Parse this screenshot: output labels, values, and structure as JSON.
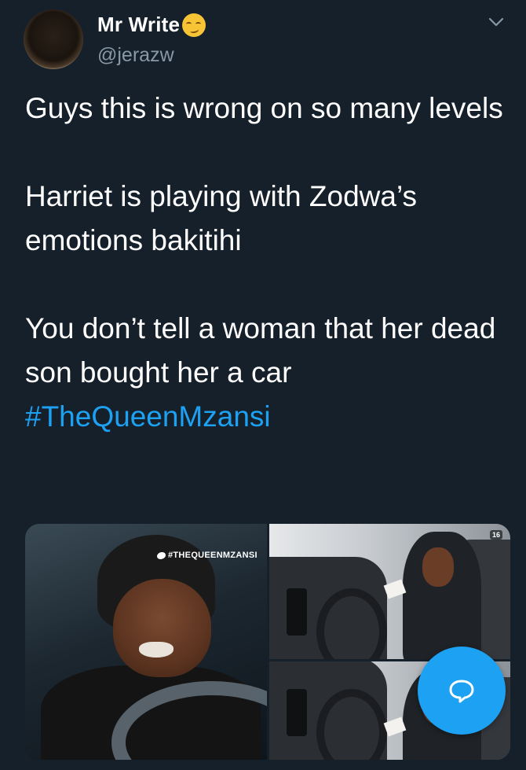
{
  "tweet": {
    "author": {
      "display_name": "Mr Write",
      "emoji_icon": "relieved-face-emoji",
      "handle": "@jerazw"
    },
    "paragraphs": [
      "Guys this is wrong on so many levels",
      "Harriet is playing with Zodwa’s emotions bakitihi",
      "You don’t tell a woman that her dead son bought her a car"
    ],
    "hashtag": "#TheQueenMzansi",
    "media": {
      "watermark": "#THEQUEENMZANSI",
      "channel_badge": "16"
    }
  },
  "colors": {
    "background": "#15202b",
    "text": "#ffffff",
    "secondary_text": "#8899a6",
    "accent": "#1da1f2"
  },
  "icons": {
    "menu": "chevron-down-icon",
    "compose": "speech-bubble-icon",
    "watermark": "twitter-bird-icon"
  }
}
